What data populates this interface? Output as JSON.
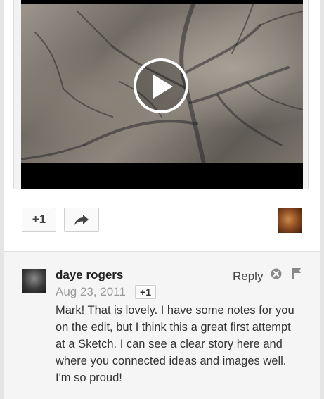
{
  "post": {
    "plus_one_label": "+1"
  },
  "comment": {
    "author": "daye rogers",
    "date": "Aug 23, 2011",
    "plus_one_label": "+1",
    "reply_label": "Reply",
    "text": "Mark! That is lovely. I have some notes for you on the edit, but I think this a great first attempt at a Sketch. I can see a clear story here and where you connected ideas and images well. I'm so proud!"
  },
  "icons": {
    "play": "play-icon",
    "share": "share-arrow-icon",
    "remove": "remove-circle-icon",
    "flag": "flag-icon"
  },
  "colors": {
    "card_bg": "#ffffff",
    "comment_bg": "#f5f5f5",
    "date_text": "#999999"
  }
}
